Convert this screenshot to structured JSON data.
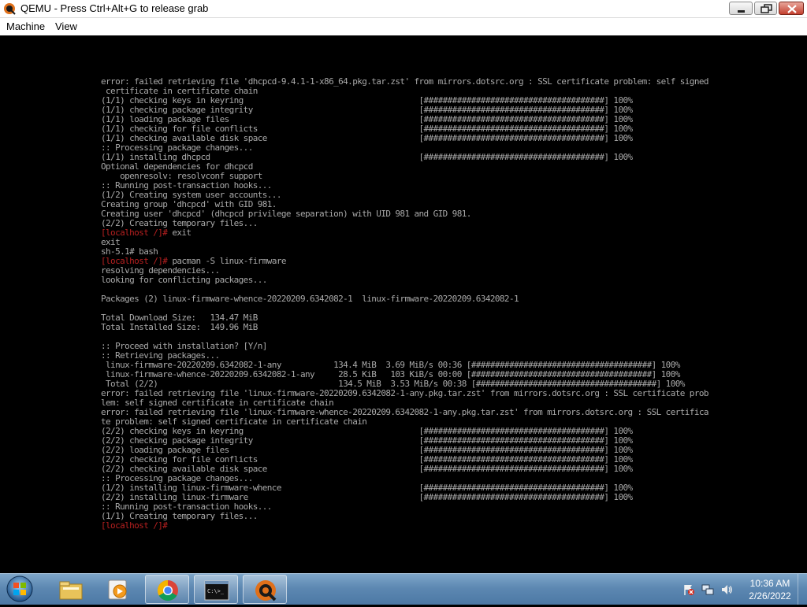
{
  "window": {
    "title": "QEMU - Press Ctrl+Alt+G to release grab",
    "icon": "qemu-icon",
    "controls": [
      "minimize-icon",
      "maximize-icon",
      "close-icon"
    ]
  },
  "menu": {
    "machine": "Machine",
    "view": "View"
  },
  "terminal": {
    "lines": [
      {
        "text": "error: failed retrieving file 'dhcpcd-9.4.1-1-x86_64.pkg.tar.zst' from mirrors.dotsrc.org : SSL certificate problem: self signed"
      },
      {
        "text": " certificate in certificate chain"
      },
      {
        "text": "(1/1) checking keys in keyring                                     [######################################] 100%"
      },
      {
        "text": "(1/1) checking package integrity                                   [######################################] 100%"
      },
      {
        "text": "(1/1) loading package files                                        [######################################] 100%"
      },
      {
        "text": "(1/1) checking for file conflicts                                  [######################################] 100%"
      },
      {
        "text": "(1/1) checking available disk space                                [######################################] 100%"
      },
      {
        "text": ":: Processing package changes..."
      },
      {
        "text": "(1/1) installing dhcpcd                                            [######################################] 100%"
      },
      {
        "text": "Optional dependencies for dhcpcd"
      },
      {
        "text": "    openresolv: resolvconf support"
      },
      {
        "text": ":: Running post-transaction hooks..."
      },
      {
        "text": "(1/2) Creating system user accounts..."
      },
      {
        "text": "Creating group 'dhcpcd' with GID 981."
      },
      {
        "text": "Creating user 'dhcpcd' (dhcpcd privilege separation) with UID 981 and GID 981."
      },
      {
        "text": "(2/2) Creating temporary files..."
      },
      {
        "prompt": "[localhost /]#",
        "text": " exit"
      },
      {
        "text": "exit"
      },
      {
        "text": "sh-5.1# bash"
      },
      {
        "prompt": "[localhost /]#",
        "text": " pacman -S linux-firmware"
      },
      {
        "text": "resolving dependencies..."
      },
      {
        "text": "looking for conflicting packages..."
      },
      {
        "text": ""
      },
      {
        "text": "Packages (2) linux-firmware-whence-20220209.6342082-1  linux-firmware-20220209.6342082-1"
      },
      {
        "text": ""
      },
      {
        "text": "Total Download Size:   134.47 MiB"
      },
      {
        "text": "Total Installed Size:  149.96 MiB"
      },
      {
        "text": ""
      },
      {
        "text": ":: Proceed with installation? [Y/n]"
      },
      {
        "text": ":: Retrieving packages..."
      },
      {
        "text": " linux-firmware-20220209.6342082-1-any           134.4 MiB  3.69 MiB/s 00:36 [######################################] 100%"
      },
      {
        "text": " linux-firmware-whence-20220209.6342082-1-any     28.5 KiB   103 KiB/s 00:00 [######################################] 100%"
      },
      {
        "text": " Total (2/2)                                      134.5 MiB  3.53 MiB/s 00:38 [######################################] 100%"
      },
      {
        "text": "error: failed retrieving file 'linux-firmware-20220209.6342082-1-any.pkg.tar.zst' from mirrors.dotsrc.org : SSL certificate prob"
      },
      {
        "text": "lem: self signed certificate in certificate chain"
      },
      {
        "text": "error: failed retrieving file 'linux-firmware-whence-20220209.6342082-1-any.pkg.tar.zst' from mirrors.dotsrc.org : SSL certifica"
      },
      {
        "text": "te problem: self signed certificate in certificate chain"
      },
      {
        "text": "(2/2) checking keys in keyring                                     [######################################] 100%"
      },
      {
        "text": "(2/2) checking package integrity                                   [######################################] 100%"
      },
      {
        "text": "(2/2) loading package files                                        [######################################] 100%"
      },
      {
        "text": "(2/2) checking for file conflicts                                  [######################################] 100%"
      },
      {
        "text": "(2/2) checking available disk space                                [######################################] 100%"
      },
      {
        "text": ":: Processing package changes..."
      },
      {
        "text": "(1/2) installing linux-firmware-whence                             [######################################] 100%"
      },
      {
        "text": "(2/2) installing linux-firmware                                    [######################################] 100%"
      },
      {
        "text": ":: Running post-transaction hooks..."
      },
      {
        "text": "(1/1) Creating temporary files..."
      },
      {
        "prompt": "[localhost /]#",
        "text": ""
      }
    ],
    "fg_color": "#aaaaaa",
    "prompt_color": "#b82020"
  },
  "taskbar": {
    "start_icon": "windows-start-icon",
    "apps": [
      "file-explorer-icon",
      "media-player-icon",
      "chrome-icon",
      "command-prompt-icon",
      "qemu-icon"
    ],
    "tray_icons": [
      "action-center-flag-icon",
      "network-icon",
      "volume-icon"
    ],
    "clock": {
      "time": "10:36 AM",
      "date": "2/26/2022"
    }
  }
}
